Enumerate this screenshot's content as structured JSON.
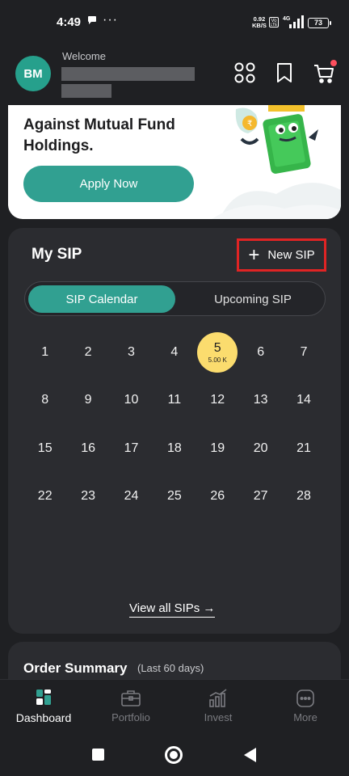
{
  "status_bar": {
    "time": "4:49",
    "net_speed_value": "0.92",
    "net_speed_unit": "KB/S",
    "volte": "Vo LTE",
    "network": "4G",
    "battery": "73"
  },
  "header": {
    "avatar_initials": "BM",
    "welcome_label": "Welcome"
  },
  "banner": {
    "title": "Against Mutual Fund Holdings.",
    "apply_button": "Apply Now"
  },
  "sip": {
    "title": "My SIP",
    "new_sip_label": "New SIP",
    "tabs": [
      "SIP Calendar",
      "Upcoming SIP"
    ],
    "active_tab": "SIP Calendar",
    "calendar_weeks": [
      [
        "1",
        "2",
        "3",
        "4",
        "5",
        "6",
        "7"
      ],
      [
        "8",
        "9",
        "10",
        "11",
        "12",
        "13",
        "14"
      ],
      [
        "15",
        "16",
        "17",
        "18",
        "19",
        "20",
        "21"
      ],
      [
        "22",
        "23",
        "24",
        "25",
        "26",
        "27",
        "28"
      ]
    ],
    "highlight": {
      "day": "5",
      "amount": "5.00 K"
    },
    "view_all": "View all SIPs →"
  },
  "order_summary": {
    "title": "Order Summary",
    "subtitle": "(Last 60 days)"
  },
  "bottom_nav": [
    {
      "label": "Dashboard",
      "icon": "dashboard-icon",
      "active": true
    },
    {
      "label": "Portfolio",
      "icon": "briefcase-icon",
      "active": false
    },
    {
      "label": "Invest",
      "icon": "chart-icon",
      "active": false
    },
    {
      "label": "More",
      "icon": "more-icon",
      "active": false
    }
  ],
  "colors": {
    "background": "#1f2023",
    "card": "#2b2c30",
    "accent": "#31a091",
    "highlight": "#fbdc6e",
    "outline": "#e02424"
  }
}
